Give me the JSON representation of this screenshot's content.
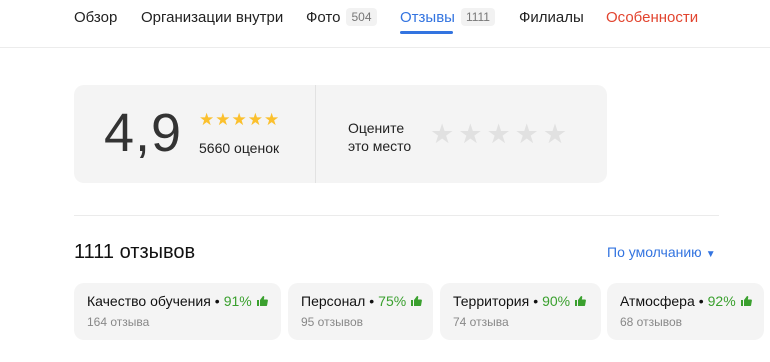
{
  "tabs": [
    {
      "label": "Обзор",
      "count": null
    },
    {
      "label": "Организации внутри",
      "count": null
    },
    {
      "label": "Фото",
      "count": "504"
    },
    {
      "label": "Отзывы",
      "count": "1111"
    },
    {
      "label": "Филиалы",
      "count": null
    },
    {
      "label": "Особенности",
      "count": null
    }
  ],
  "active_tab": "Отзывы",
  "rating": {
    "value": "4,9",
    "stars_filled": 5,
    "count_text": "5660 оценок"
  },
  "rate_prompt": {
    "line1": "Оцените",
    "line2": "это место"
  },
  "reviews": {
    "title": "1111 отзывов",
    "sort_label": "По умолчанию"
  },
  "aspects": [
    {
      "name": "Качество обучения",
      "percent": "91%",
      "count": "164 отзыва"
    },
    {
      "name": "Персонал",
      "percent": "75%",
      "count": "95 отзывов"
    },
    {
      "name": "Территория",
      "percent": "90%",
      "count": "74 отзыва"
    },
    {
      "name": "Атмосфера",
      "percent": "92%",
      "count": "68 отзывов"
    }
  ],
  "colors": {
    "accent": "#3374e0",
    "highlight": "#e2442f",
    "star": "#fbc02d",
    "positive": "#3aa02e"
  },
  "icons": {
    "star": "star-icon",
    "thumb": "thumbs-up-icon",
    "caret": "caret-down-icon"
  }
}
